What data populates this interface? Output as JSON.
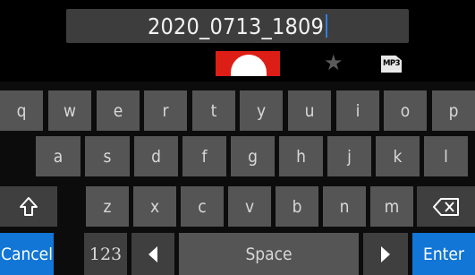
{
  "name_field": {
    "value": "2020_0713_1809"
  },
  "icons": {
    "rec": "record-icon",
    "mark": "star-icon",
    "format": "mp3-file-icon",
    "format_label": "MP3"
  },
  "keyboard": {
    "row1": [
      "q",
      "w",
      "e",
      "r",
      "t",
      "y",
      "u",
      "i",
      "o",
      "p"
    ],
    "row2": [
      "a",
      "s",
      "d",
      "f",
      "g",
      "h",
      "j",
      "k",
      "l"
    ],
    "row3": [
      "z",
      "x",
      "c",
      "v",
      "b",
      "n",
      "m"
    ],
    "cancel": "Cancel",
    "numbers": "123",
    "space": "Space",
    "enter": "Enter",
    "shift_icon": "shift-icon",
    "backspace_icon": "backspace-icon",
    "left_icon": "cursor-left-icon",
    "right_icon": "cursor-right-icon"
  },
  "colors": {
    "accent": "#1276d6",
    "record": "#dd1e16",
    "caret": "#2f7fe0"
  }
}
